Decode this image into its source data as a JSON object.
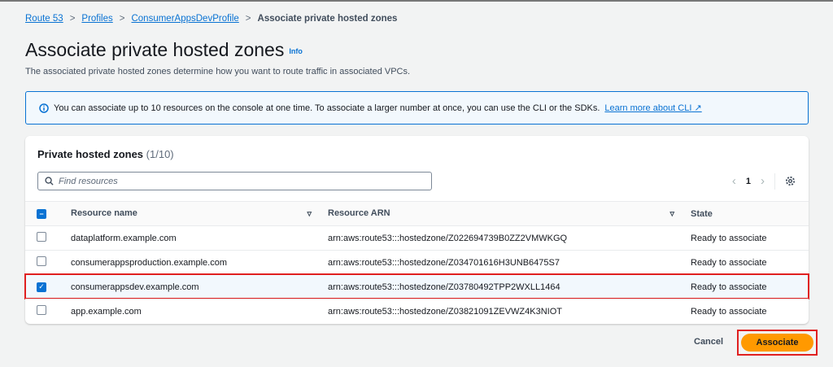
{
  "breadcrumb": [
    "Route 53",
    "Profiles",
    "ConsumerAppsDevProfile",
    "Associate private hosted zones"
  ],
  "page": {
    "title": "Associate private hosted zones",
    "info": "Info",
    "description": "The associated private hosted zones determine how you want to route traffic in associated VPCs."
  },
  "banner": {
    "text": "You can associate up to 10 resources on the console at one time. To associate a larger number at once, you can use the CLI or the SDKs.",
    "link": "Learn more about CLI"
  },
  "table": {
    "title": "Private hosted zones",
    "count": "(1/10)",
    "search_placeholder": "Find resources",
    "page": "1",
    "headers": [
      "Resource name",
      "Resource ARN",
      "State"
    ],
    "rows": [
      {
        "name": "dataplatform.example.com",
        "arn": "arn:aws:route53:::hostedzone/Z022694739B0ZZ2VMWKGQ",
        "state": "Ready to associate",
        "checked": false
      },
      {
        "name": "consumerappsproduction.example.com",
        "arn": "arn:aws:route53:::hostedzone/Z034701616H3UNB6475S7",
        "state": "Ready to associate",
        "checked": false
      },
      {
        "name": "consumerappsdev.example.com",
        "arn": "arn:aws:route53:::hostedzone/Z03780492TPP2WXLL1464",
        "state": "Ready to associate",
        "checked": true
      },
      {
        "name": "app.example.com",
        "arn": "arn:aws:route53:::hostedzone/Z03821091ZEVWZ4K3NIOT",
        "state": "Ready to associate",
        "checked": false
      }
    ]
  },
  "actions": {
    "cancel": "Cancel",
    "associate": "Associate"
  }
}
